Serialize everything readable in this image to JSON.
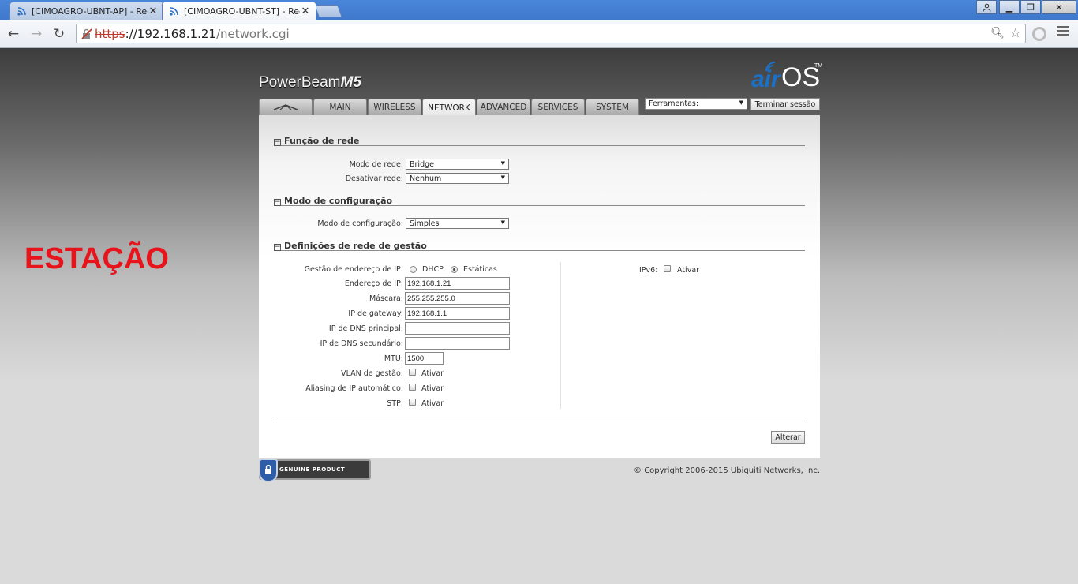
{
  "browser": {
    "tabs": [
      {
        "title": "[CIMOAGRO-UBNT-AP] - Rec",
        "active": false
      },
      {
        "title": "[CIMOAGRO-UBNT-ST] - Rec",
        "active": true
      }
    ],
    "url_scheme": "https",
    "url_host": "://192.168.1.21",
    "url_path": "/network.cgi"
  },
  "overlay_label": "ESTAÇÃO",
  "device": {
    "brand_prefix": "PowerBeam",
    "brand_model": "M5",
    "os_air": "air",
    "os_name": "OS",
    "os_tm": "TM"
  },
  "nav": {
    "tabs": [
      "MAIN",
      "WIRELESS",
      "NETWORK",
      "ADVANCED",
      "SERVICES",
      "SYSTEM"
    ],
    "active": "NETWORK",
    "tools_select": "Ferramentas:",
    "logout_label": "Terminar sessão"
  },
  "sections": {
    "network_role": {
      "title": "Função de rede",
      "network_mode_label": "Modo de rede:",
      "network_mode_value": "Bridge",
      "disable_network_label": "Desativar rede:",
      "disable_network_value": "Nenhum"
    },
    "config_mode": {
      "title": "Modo de configuração",
      "config_mode_label": "Modo de configuração:",
      "config_mode_value": "Simples"
    },
    "management": {
      "title": "Definições de rede de gestão",
      "ip_mgmt_label": "Gestão de endereço de IP:",
      "dhcp_label": "DHCP",
      "static_label": "Estáticas",
      "static_selected": true,
      "ip_label": "Endereço de IP:",
      "ip_value": "192.168.1.21",
      "mask_label": "Máscara:",
      "mask_value": "255.255.255.0",
      "gateway_label": "IP de gateway:",
      "gateway_value": "192.168.1.1",
      "dns1_label": "IP de DNS principal:",
      "dns1_value": "",
      "dns2_label": "IP de DNS secundário:",
      "dns2_value": "",
      "mtu_label": "MTU:",
      "mtu_value": "1500",
      "vlan_label": "VLAN de gestão:",
      "aliasing_label": "Aliasing de IP automático:",
      "stp_label": "STP:",
      "enable_label": "Ativar",
      "ipv6_label": "IPv6:"
    }
  },
  "apply_label": "Alterar",
  "genuine_badge": "GENUINE  PRODUCT",
  "copyright": "© Copyright 2006-2015 Ubiquiti Networks, Inc."
}
